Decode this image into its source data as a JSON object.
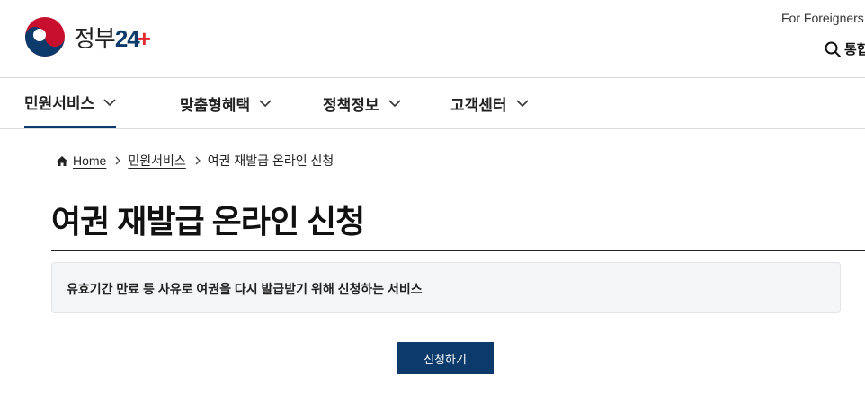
{
  "header": {
    "logo": {
      "text_ko": "정부",
      "text_num": "24",
      "icon": "taegeuk-emblem-icon"
    },
    "foreigners_link": "For Foreigners",
    "search": {
      "icon": "search-icon",
      "label": "통합"
    }
  },
  "gnb": {
    "items": [
      {
        "label": "민원서비스",
        "active": true
      },
      {
        "label": "맞춤형혜택",
        "active": false
      },
      {
        "label": "정책정보",
        "active": false
      },
      {
        "label": "고객센터",
        "active": false
      }
    ]
  },
  "breadcrumb": {
    "home": "Home",
    "level1": "민원서비스",
    "current": "여권 재발급 온라인 신청"
  },
  "page": {
    "title": "여권 재발급 온라인 신청",
    "description": "유효기간 만료 등 사유로 여권을 다시 발급받기 위해 신청하는 서비스",
    "apply_button": "신청하기"
  },
  "colors": {
    "primary": "#0b3a6b",
    "accent_red": "#e2292d",
    "box_bg": "#f4f5f6"
  }
}
